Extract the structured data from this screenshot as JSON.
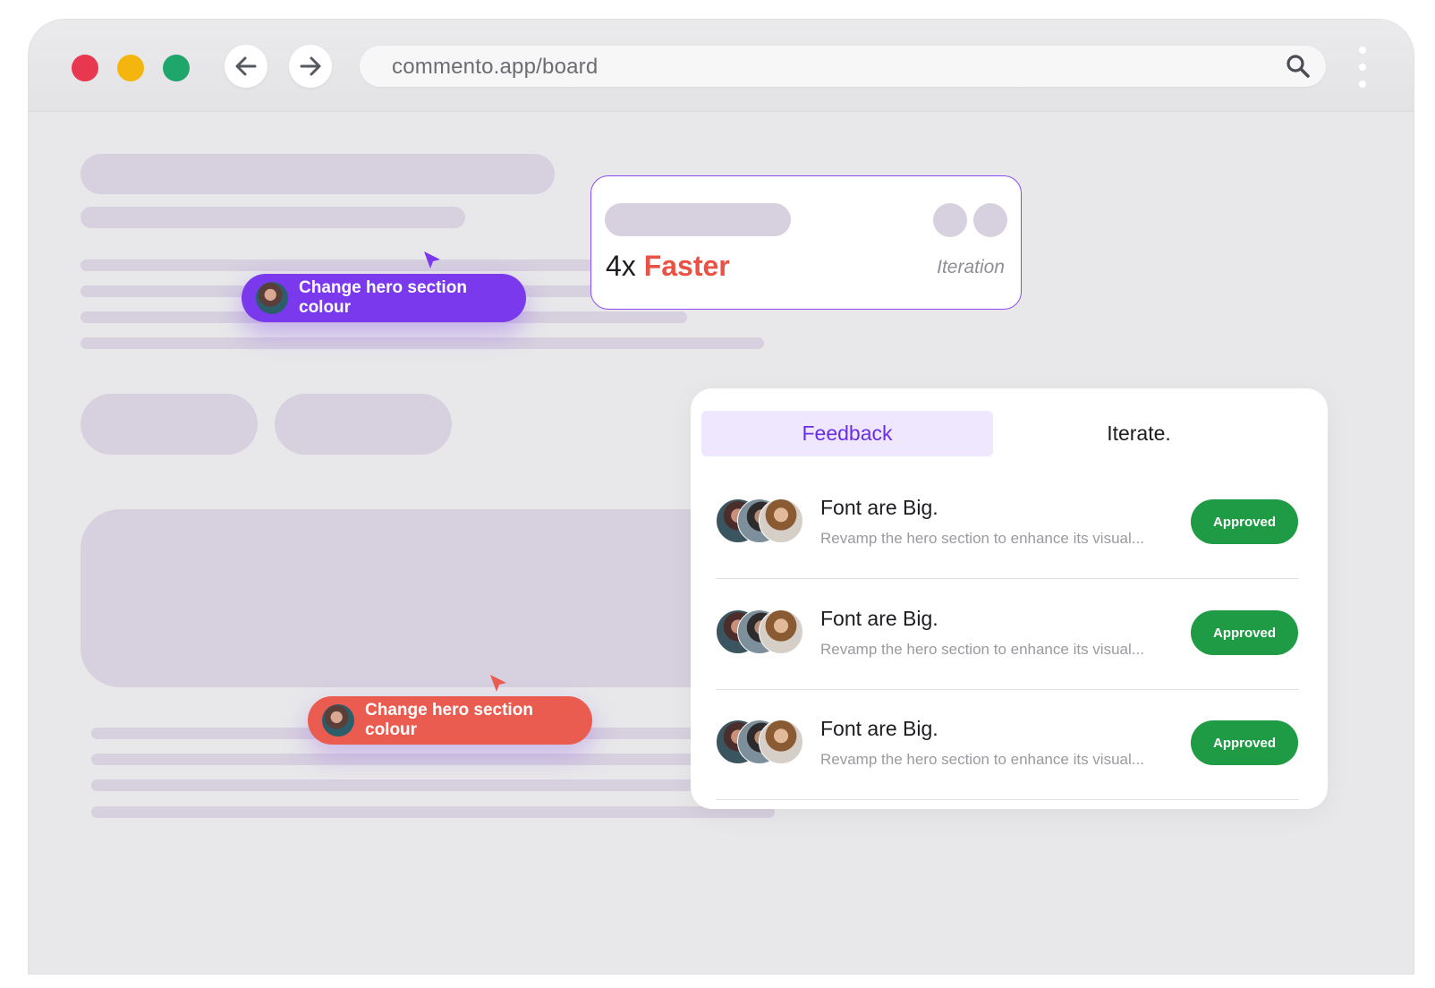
{
  "browser": {
    "url": "commento.app/board",
    "traffic_lights": [
      "#e8384f",
      "#f5b50f",
      "#1fa66a"
    ],
    "back_icon": "arrow-left-icon",
    "forward_icon": "arrow-right-icon",
    "search_icon": "search-icon",
    "menu_icon": "kebab-menu-icon"
  },
  "comments": [
    {
      "text": "Change hero section colour",
      "color": "#7b39ee"
    },
    {
      "text": "Change hero section colour",
      "color": "#ea5c50"
    }
  ],
  "stat_card": {
    "multiplier": "4x",
    "highlight": "Faster",
    "subtitle": "Iteration"
  },
  "feedback_panel": {
    "tabs": [
      {
        "label": "Feedback",
        "active": true
      },
      {
        "label": "Iterate.",
        "active": false
      }
    ],
    "items": [
      {
        "title": "Font are Big.",
        "description": "Revamp the hero section to enhance its visual...",
        "status": "Approved"
      },
      {
        "title": "Font are Big.",
        "description": "Revamp the hero section to enhance its visual...",
        "status": "Approved"
      },
      {
        "title": "Font are Big.",
        "description": "Revamp the hero section to enhance its visual...",
        "status": "Approved"
      }
    ]
  },
  "colors": {
    "accent_purple": "#7b39ee",
    "accent_red": "#ea5245",
    "approved_green": "#1f9b45",
    "skeleton": "#d6d0df"
  }
}
